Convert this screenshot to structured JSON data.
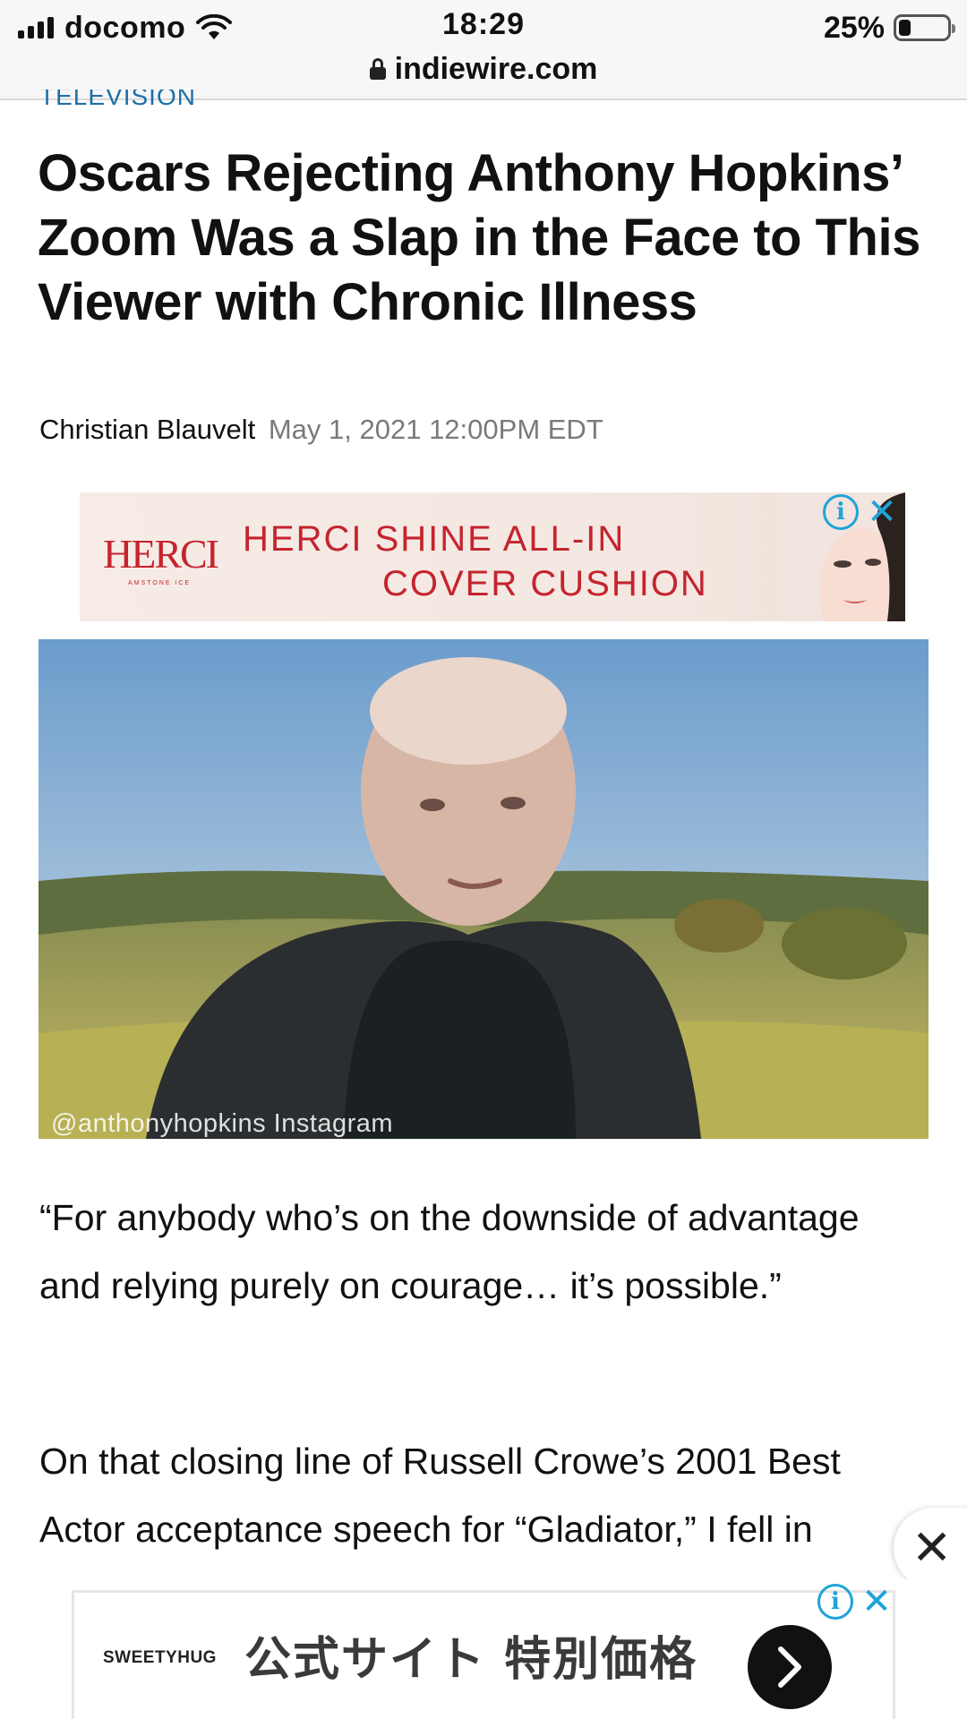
{
  "status_bar": {
    "carrier": "docomo",
    "time": "18:29",
    "battery_percent": "25%",
    "battery_level": 0.25
  },
  "browser": {
    "url": "indiewire.com"
  },
  "article": {
    "category": "TELEVISION",
    "headline": "Oscars Rejecting Anthony Hopkins’ Zoom Was a Slap in the Face to This Viewer with Chronic Illness",
    "author": "Christian Blauvelt",
    "date": "May 1, 2021 12:00PM EDT",
    "photo_credit": "@anthonyhopkins Instagram",
    "paragraph1": "“For anybody who’s on the downside of advantage and relying purely on courage… it’s possible.”",
    "paragraph2": "On that closing line of Russell Crowe’s 2001 Best Actor acceptance speech for “Gladiator,” I fell in"
  },
  "ad_top": {
    "logo": "HERCI",
    "logo_sub": "AMSTONE ICE",
    "line1": "HERCI SHINE ALL-IN",
    "line2": "COVER CUSHION",
    "info_icon": "i",
    "close_icon": "✕"
  },
  "float_close": "✕",
  "ad_bottom": {
    "brand": "SWEETYHUG",
    "text": "公式サイト 特別価格",
    "info_icon": "i",
    "close_icon": "✕"
  },
  "colors": {
    "accent_link": "#1c6fa8",
    "ad_red": "#c4242e",
    "ad_info_blue": "#1fa3d9"
  }
}
